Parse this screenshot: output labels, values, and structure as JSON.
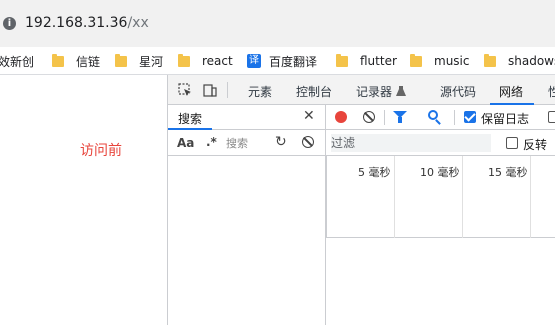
{
  "browser": {
    "url_host": "192.168.31.36",
    "url_path": "/xx",
    "site_icon": "globe-icon"
  },
  "bookmarks": [
    {
      "label": "效新创",
      "icon": "none"
    },
    {
      "label": "信链",
      "icon": "folder-icon"
    },
    {
      "label": "星河",
      "icon": "folder-icon"
    },
    {
      "label": "react",
      "icon": "folder-icon"
    },
    {
      "label": "百度翻译",
      "icon": "translate-icon",
      "badge": "译"
    },
    {
      "label": "flutter",
      "icon": "folder-icon"
    },
    {
      "label": "music",
      "icon": "folder-icon"
    },
    {
      "label": "shadows",
      "icon": "folder-icon"
    }
  ],
  "page": {
    "visit_label": "访问前",
    "visit_label_color": "#e8453c"
  },
  "devtools": {
    "tabs": [
      {
        "label": "元素"
      },
      {
        "label": "控制台"
      },
      {
        "label": "记录器",
        "suffix_icon": "flask-icon"
      },
      {
        "label": "源代码"
      },
      {
        "label": "网络",
        "active": true
      },
      {
        "label": "性"
      }
    ],
    "search": {
      "title": "搜索",
      "case_label": "Aa",
      "regex_label": ".*",
      "placeholder": "搜索"
    },
    "network": {
      "preserve_log_label": "保留日志",
      "preserve_log_checked": true,
      "filter_placeholder": "过滤",
      "invert_label": "反转",
      "invert_checked": false,
      "timeline_ticks": [
        "5 毫秒",
        "10 毫秒",
        "15 毫秒"
      ],
      "accent_color": "#1a73e8"
    }
  }
}
